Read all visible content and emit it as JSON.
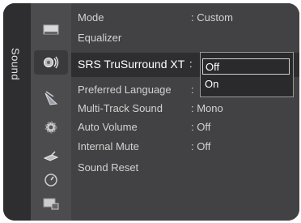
{
  "category": {
    "label": "Sound"
  },
  "icons": [
    {
      "name": "picture-icon"
    },
    {
      "name": "sound-icon",
      "selected": true
    },
    {
      "name": "channel-icon"
    },
    {
      "name": "setup-icon"
    },
    {
      "name": "input-icon"
    },
    {
      "name": "application-icon"
    },
    {
      "name": "support-icon"
    }
  ],
  "menu": {
    "items": [
      {
        "label": "Mode",
        "value": ": Custom"
      },
      {
        "label": "Equalizer",
        "value": ""
      },
      {
        "label": "SRS TruSurround XT",
        "value": ":"
      },
      {
        "label": "Preferred Language",
        "value": ":"
      },
      {
        "label": "Multi-Track Sound",
        "value": ": Mono"
      },
      {
        "label": "Auto Volume",
        "value": ": Off"
      },
      {
        "label": "Internal Mute",
        "value": ": Off"
      },
      {
        "label": "Sound Reset",
        "value": ""
      }
    ]
  },
  "popup": {
    "options": [
      {
        "label": "Off",
        "highlighted": true
      },
      {
        "label": "On",
        "highlighted": false
      }
    ]
  }
}
